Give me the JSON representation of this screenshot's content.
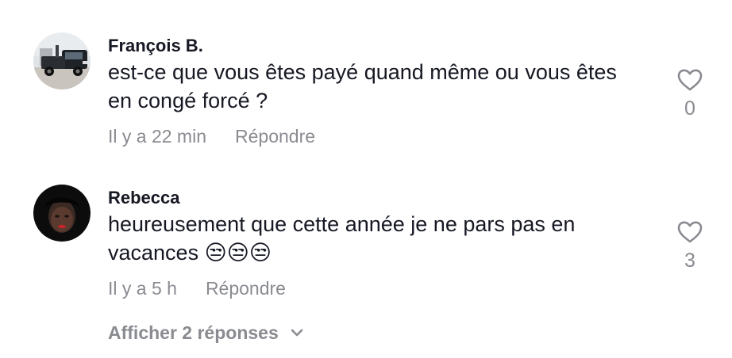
{
  "comments": [
    {
      "username": "François B.",
      "text": "est-ce que vous êtes payé quand même ou vous êtes en congé forcé ?",
      "time": "Il y a 22 min",
      "reply_label": "Répondre",
      "like_count": "0",
      "avatar_icon": "tow-truck-photo"
    },
    {
      "username": "Rebecca",
      "text": "heureusement que cette année je ne pars pas en vacances 😒😒😒",
      "time": "Il y a 5 h",
      "reply_label": "Répondre",
      "like_count": "3",
      "avatar_icon": "person-photo"
    }
  ],
  "show_replies_label": "Afficher 2 réponses",
  "colors": {
    "text": "#161823",
    "muted": "#8a8b91",
    "icon": "#8a8b91"
  }
}
